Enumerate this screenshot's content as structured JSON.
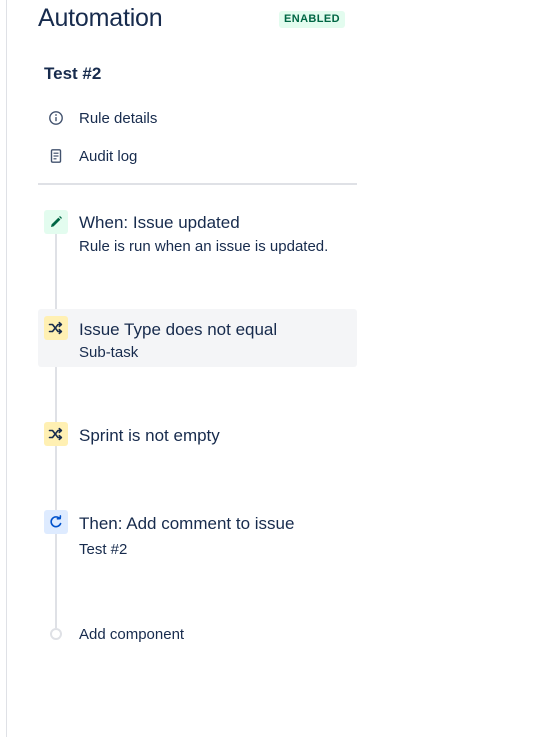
{
  "header": {
    "title": "Automation",
    "status": "ENABLED",
    "status_bg": "#e3fcef",
    "status_color": "#006644"
  },
  "rule": {
    "name": "Test #2"
  },
  "nav": {
    "items": [
      {
        "label": "Rule details",
        "icon": "info-icon"
      },
      {
        "label": "Audit log",
        "icon": "document-icon"
      }
    ]
  },
  "components": [
    {
      "kind": "trigger",
      "title": "When: Issue updated",
      "description": "Rule is run when an issue is updated.",
      "icon": "pencil-icon",
      "icon_bg": "#e3fcef",
      "icon_color": "#006644"
    },
    {
      "kind": "condition",
      "title": "Issue Type does not equal",
      "description": "Sub-task",
      "icon": "shuffle-icon",
      "icon_bg": "#fff0b3",
      "icon_color": "#172b4d",
      "selected": true
    },
    {
      "kind": "condition",
      "title": "Sprint is not empty",
      "icon": "shuffle-icon",
      "icon_bg": "#fff0b3",
      "icon_color": "#172b4d"
    },
    {
      "kind": "action",
      "title": "Then: Add comment to issue",
      "description": "Test #2",
      "icon": "refresh-icon",
      "icon_bg": "#deebff",
      "icon_color": "#0052cc"
    }
  ],
  "add_component": {
    "label": "Add component"
  }
}
